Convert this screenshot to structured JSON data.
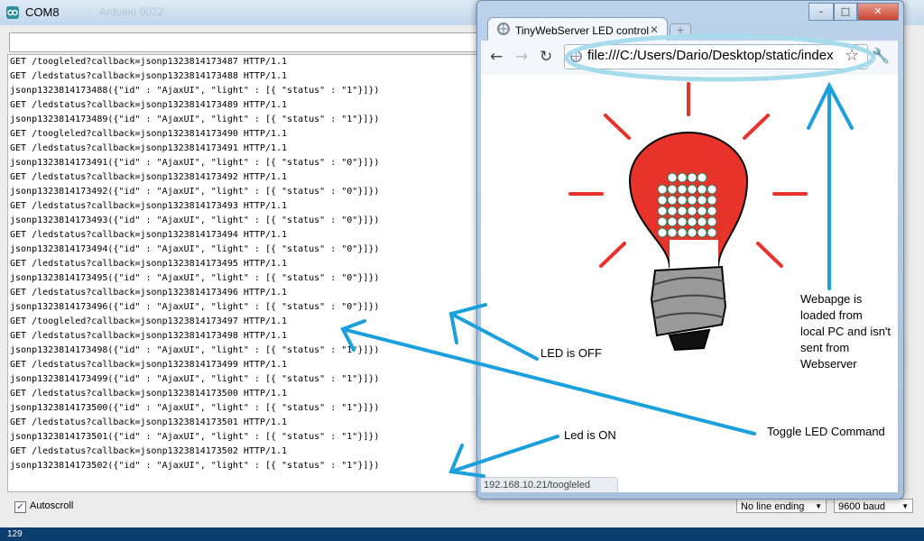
{
  "serial_monitor": {
    "title": "COM8",
    "title_ghost": "Arduino 0022",
    "log_lines": [
      "GET /toogleled?callback=jsonp1323814173487 HTTP/1.1",
      "GET /ledstatus?callback=jsonp1323814173488 HTTP/1.1",
      "jsonp1323814173488({\"id\" : \"AjaxUI\", \"light\" : [{ \"status\" : \"1\"}]})",
      "GET /ledstatus?callback=jsonp1323814173489 HTTP/1.1",
      "jsonp1323814173489({\"id\" : \"AjaxUI\", \"light\" : [{ \"status\" : \"1\"}]})",
      "GET /toogleled?callback=jsonp1323814173490 HTTP/1.1",
      "GET /ledstatus?callback=jsonp1323814173491 HTTP/1.1",
      "jsonp1323814173491({\"id\" : \"AjaxUI\", \"light\" : [{ \"status\" : \"0\"}]})",
      "GET /ledstatus?callback=jsonp1323814173492 HTTP/1.1",
      "jsonp1323814173492({\"id\" : \"AjaxUI\", \"light\" : [{ \"status\" : \"0\"}]})",
      "GET /ledstatus?callback=jsonp1323814173493 HTTP/1.1",
      "jsonp1323814173493({\"id\" : \"AjaxUI\", \"light\" : [{ \"status\" : \"0\"}]})",
      "GET /ledstatus?callback=jsonp1323814173494 HTTP/1.1",
      "jsonp1323814173494({\"id\" : \"AjaxUI\", \"light\" : [{ \"status\" : \"0\"}]})",
      "GET /ledstatus?callback=jsonp1323814173495 HTTP/1.1",
      "jsonp1323814173495({\"id\" : \"AjaxUI\", \"light\" : [{ \"status\" : \"0\"}]})",
      "GET /ledstatus?callback=jsonp1323814173496 HTTP/1.1",
      "jsonp1323814173496({\"id\" : \"AjaxUI\", \"light\" : [{ \"status\" : \"0\"}]})",
      "GET /toogleled?callback=jsonp1323814173497 HTTP/1.1",
      "GET /ledstatus?callback=jsonp1323814173498 HTTP/1.1",
      "jsonp1323814173498({\"id\" : \"AjaxUI\", \"light\" : [{ \"status\" : \"1\"}]})",
      "GET /ledstatus?callback=jsonp1323814173499 HTTP/1.1",
      "jsonp1323814173499({\"id\" : \"AjaxUI\", \"light\" : [{ \"status\" : \"1\"}]})",
      "GET /ledstatus?callback=jsonp1323814173500 HTTP/1.1",
      "jsonp1323814173500({\"id\" : \"AjaxUI\", \"light\" : [{ \"status\" : \"1\"}]})",
      "GET /ledstatus?callback=jsonp1323814173501 HTTP/1.1",
      "jsonp1323814173501({\"id\" : \"AjaxUI\", \"light\" : [{ \"status\" : \"1\"}]})",
      "GET /ledstatus?callback=jsonp1323814173502 HTTP/1.1",
      "jsonp1323814173502({\"id\" : \"AjaxUI\", \"light\" : [{ \"status\" : \"1\"}]})"
    ],
    "autoscroll_label": "Autoscroll",
    "autoscroll_checked": true,
    "line_ending": "No line ending",
    "baud": "9600 baud",
    "status_bar_text": "129"
  },
  "browser": {
    "tab_title": "TinyWebServer LED control",
    "url": "file:///C:/Users/Dario/Desktop/static/index",
    "status_url": "192.168.10.21/toogleled",
    "icons": [
      "back-icon",
      "forward-icon",
      "reload-icon",
      "globe-icon",
      "star-icon",
      "wrench-icon"
    ]
  },
  "annotations": {
    "led_off": "LED is OFF",
    "led_on": "Led is ON",
    "toggle": "Toggle LED Command",
    "webpage_note": [
      "Webapge is",
      "loaded from",
      "local PC and isn't",
      "sent from",
      "Webserver"
    ]
  },
  "colors": {
    "arrow": "#1aa0dc",
    "bulb_red": "#e8332b",
    "url_highlight": "#a6dceb"
  }
}
